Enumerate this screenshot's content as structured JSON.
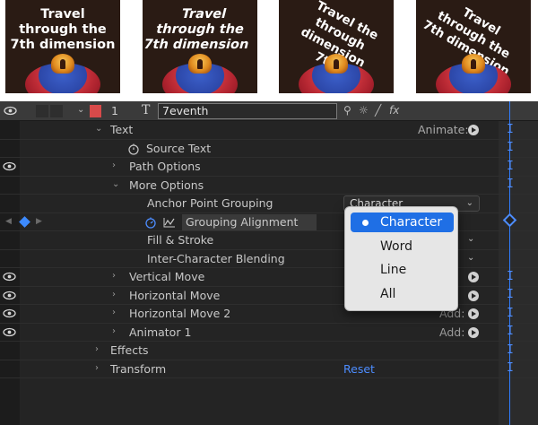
{
  "thumbnails": [
    {
      "text": "Travel\nthrough the\n7th dimension"
    },
    {
      "text": "Travel\nthrough the\n7th dimension"
    },
    {
      "text": "Travel the\nthrough dimension\n7th"
    },
    {
      "text": "Travel\nthrough the\n7th dimension"
    }
  ],
  "layer": {
    "number": "1",
    "type_glyph": "T",
    "name": "7eventh"
  },
  "rows": {
    "text": "Text",
    "animate": "Animate:",
    "source_text": "Source Text",
    "path_options": "Path Options",
    "more_options": "More Options",
    "anchor_point_grouping": "Anchor Point Grouping",
    "anchor_value": "Character",
    "grouping_alignment": "Grouping Alignment",
    "fill_stroke": "Fill & Stroke",
    "inter_char_blending": "Inter-Character Blending",
    "vertical_move": "Vertical Move",
    "horizontal_move": "Horizontal Move",
    "horizontal_move_2": "Horizontal Move 2",
    "animator_1": "Animator 1",
    "add": "Add:",
    "effects": "Effects",
    "transform": "Transform",
    "reset": "Reset"
  },
  "menu": {
    "items": [
      "Character",
      "Word",
      "Line",
      "All"
    ],
    "selected": "Character"
  },
  "colors": {
    "accent": "#1f6fe5",
    "playhead": "#2f7dff",
    "label": "#d84a4a"
  }
}
